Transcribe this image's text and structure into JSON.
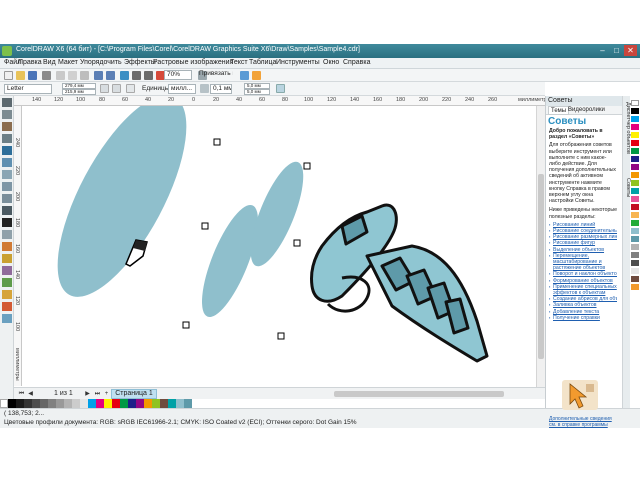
{
  "window": {
    "title": "CorelDRAW X6 (64 бит) - [C:\\Program Files\\Corel\\CorelDRAW Graphics Suite X6\\Draw\\Samples\\Sample4.cdr]",
    "controls": [
      "–",
      "□",
      "✕"
    ]
  },
  "menu": {
    "items": [
      "Файл",
      "Правка",
      "Вид",
      "Макет",
      "Упорядочить",
      "Эффекты",
      "Растровые изображения",
      "Текст",
      "Таблица",
      "Инструменты",
      "Окно",
      "Справка"
    ]
  },
  "toolbar": {
    "zoom_value": "70%",
    "snap_label": "Привязать к"
  },
  "propbar": {
    "page_size": "Letter",
    "width_value": "279,4 мм",
    "height_value": "215,9 мм",
    "units_label": "Единицы:",
    "units_value": "милл...",
    "nudge_value": "0,1 мм",
    "dup_x": "5,0 мм",
    "dup_y": "5,0 мм"
  },
  "ruler": {
    "h_labels": [
      "140",
      "120",
      "100",
      "80",
      "60",
      "40",
      "20",
      "0",
      "20",
      "40",
      "60",
      "80",
      "100",
      "120",
      "140",
      "160",
      "180",
      "200",
      "220",
      "240",
      "260",
      "280"
    ],
    "unit": "миллиметры",
    "v_unit": "миллиметры",
    "v_labels": [
      "240",
      "220",
      "200",
      "180",
      "160",
      "140",
      "120",
      "100",
      "80",
      "60"
    ]
  },
  "pagenav": {
    "page_counter": "1 из 1",
    "page_tab": "Страница 1"
  },
  "status": {
    "coords": "( 138,753; 2...",
    "profiles": "Цветовые профили документа: RGB: sRGB IEC61966-2.1; CMYK: ISO Coated v2 (ECI); Оттенки серого: Dot Gain 15%"
  },
  "docker": {
    "header": "Советы",
    "tabs": [
      "Темы",
      "Видеоролики"
    ],
    "title": "Советы",
    "welcome": "Добро пожаловать в раздел «Советы»",
    "intro": "Для отображения советов выберите инструмент или выполните с ним какое-либо действие. Для получения дополнительных сведений об активном инструменте нажмите кнопку Справка в правом верхнем углу окна настройки Советы.",
    "topics_intro": "Ниже приведены некоторые полезные разделы:",
    "links": [
      "Рисование линий",
      "Рисование соединительных линий",
      "Рисование размерных линий",
      "Рисование фигур",
      "Выделение объектов",
      "Перемещение, масштабирование и растяжение объектов",
      "Поворот и наклон объектов",
      "Формирование объектов",
      "Применение специальных эффектов к объектам",
      "Создание абрисов для объектов",
      "Заливка объектов",
      "Добавление текста",
      "Получение справки"
    ],
    "footer_link": "Дополнительные сведения см. в справке программы"
  },
  "side_tabs": [
    "Диспетчер объектов",
    "Советы"
  ],
  "colors": {
    "accent": "#2a8fc0",
    "title_bar": "#2f7a8c",
    "ellipse_fill": "#8fbfcc",
    "screw_fill": "#8fc6d2",
    "page_tab": "#bfe0f0"
  },
  "icons": [
    "app-icon",
    "pick-tool-icon",
    "shape-tool-icon",
    "crop-tool-icon",
    "zoom-tool-icon",
    "freehand-tool-icon",
    "rectangle-tool-icon",
    "ellipse-tool-icon",
    "polygon-tool-icon",
    "text-tool-icon",
    "fill-tool-icon"
  ]
}
